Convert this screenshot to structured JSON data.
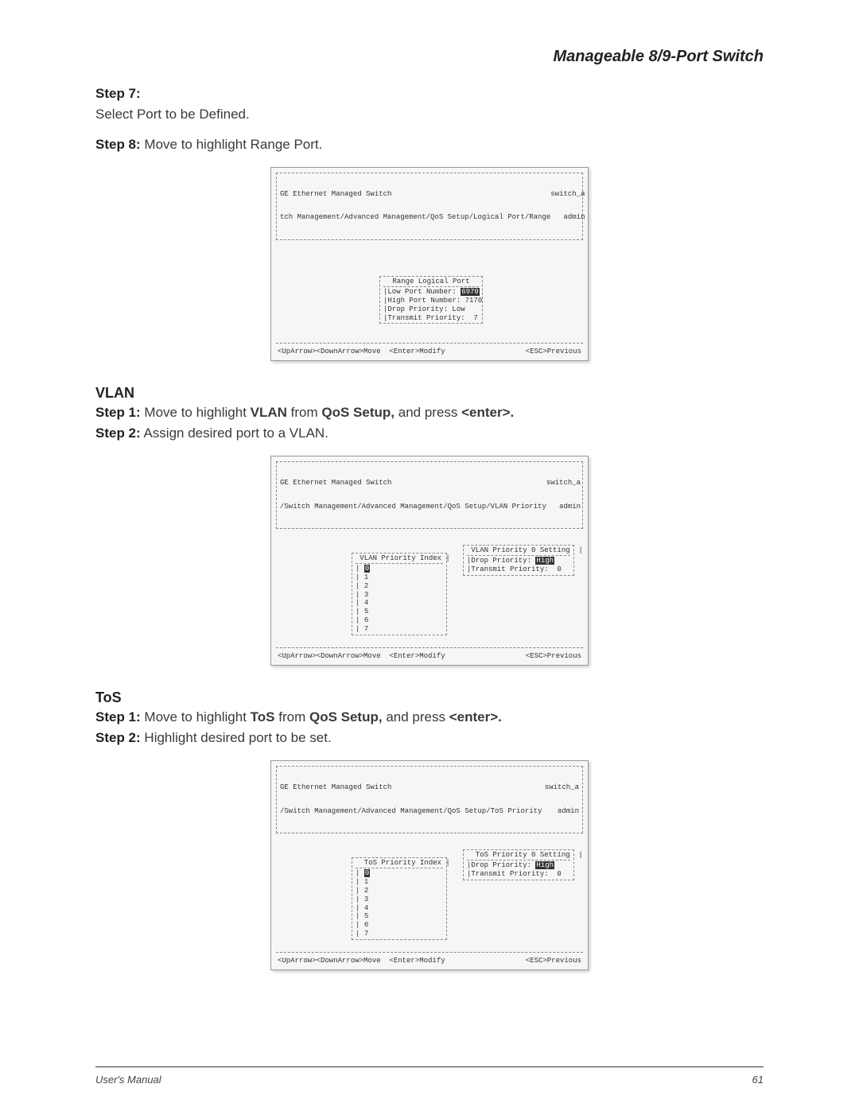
{
  "header_title": "Manageable 8/9-Port Switch",
  "step7": {
    "label": "Step 7:",
    "text": "Select Port to be Defined."
  },
  "step8": {
    "label": "Step 8:",
    "text": " Move to highlight Range Port."
  },
  "screenshot1": {
    "title": "GE Ethernet Managed Switch",
    "breadcrumb": "tch Management/Advanced Management/QoS Setup/Logical Port/Range",
    "host": "switch_a",
    "user": "admin",
    "box_title": "Range Logical Port",
    "rows": [
      {
        "label": "|Low Port Number: ",
        "value": "6970",
        "highlight": true
      },
      {
        "label": "|High Port Number: ",
        "value": "7170",
        "highlight": false
      },
      {
        "label": "|Drop Priority: ",
        "value": "Low",
        "highlight": false
      },
      {
        "label": "|Transmit Priority:  ",
        "value": "7",
        "highlight": false
      }
    ],
    "footer_left": "<UpArrow><DownArrow>Move  <Enter>Modify",
    "footer_right": "<ESC>Previous"
  },
  "vlan_title": "VLAN",
  "vlan_step1": {
    "label": "Step 1:",
    "pre": " Move to highlight ",
    "b1": "VLAN",
    "mid": " from ",
    "b2": "QoS Setup,",
    "post": " and press ",
    "b3": "<enter>."
  },
  "vlan_step2": {
    "label": "Step 2:",
    "text": " Assign desired port to a VLAN."
  },
  "screenshot2": {
    "title": "GE Ethernet Managed Switch",
    "breadcrumb": "/Switch Management/Advanced Management/QoS Setup/VLAN Priority",
    "host": "switch_a",
    "user": "admin",
    "idx_title": " VLAN Priority Index |",
    "idx_values": [
      "0",
      "1",
      "2",
      "3",
      "4",
      "5",
      "6",
      "7"
    ],
    "set_title": " VLAN Priority 0 Setting  |",
    "set_rows": [
      {
        "label": "|Drop Priority: ",
        "value": "High",
        "highlight": true
      },
      {
        "label": "|Transmit Priority:  ",
        "value": "0",
        "highlight": false
      }
    ],
    "footer_left": "<UpArrow><DownArrow>Move  <Enter>Modify",
    "footer_right": "<ESC>Previous"
  },
  "tos_title": "ToS",
  "tos_step1": {
    "label": "Step 1:",
    "pre": " Move to highlight ",
    "b1": "ToS",
    "mid": " from ",
    "b2": "QoS Setup,",
    "post": " and press ",
    "b3": "<enter>."
  },
  "tos_step2": {
    "label": "Step 2:",
    "text": " Highlight desired port to be set."
  },
  "screenshot3": {
    "title": "GE Ethernet Managed Switch",
    "breadcrumb": "/Switch Management/Advanced Management/QoS Setup/ToS Priority",
    "host": "switch_a",
    "user": "admin",
    "idx_title": "  ToS Priority Index |",
    "idx_values": [
      "0",
      "1",
      "2",
      "3",
      "4",
      "5",
      "6",
      "7"
    ],
    "set_title": "  ToS Priority 0 Setting  |",
    "set_rows": [
      {
        "label": "|Drop Priority: ",
        "value": "High",
        "highlight": true
      },
      {
        "label": "|Transmit Priority:  ",
        "value": "0",
        "highlight": false
      }
    ],
    "footer_left": "<UpArrow><DownArrow>Move  <Enter>Modify",
    "footer_right": "<ESC>Previous"
  },
  "footer": {
    "left": "User's Manual",
    "right": "61"
  }
}
